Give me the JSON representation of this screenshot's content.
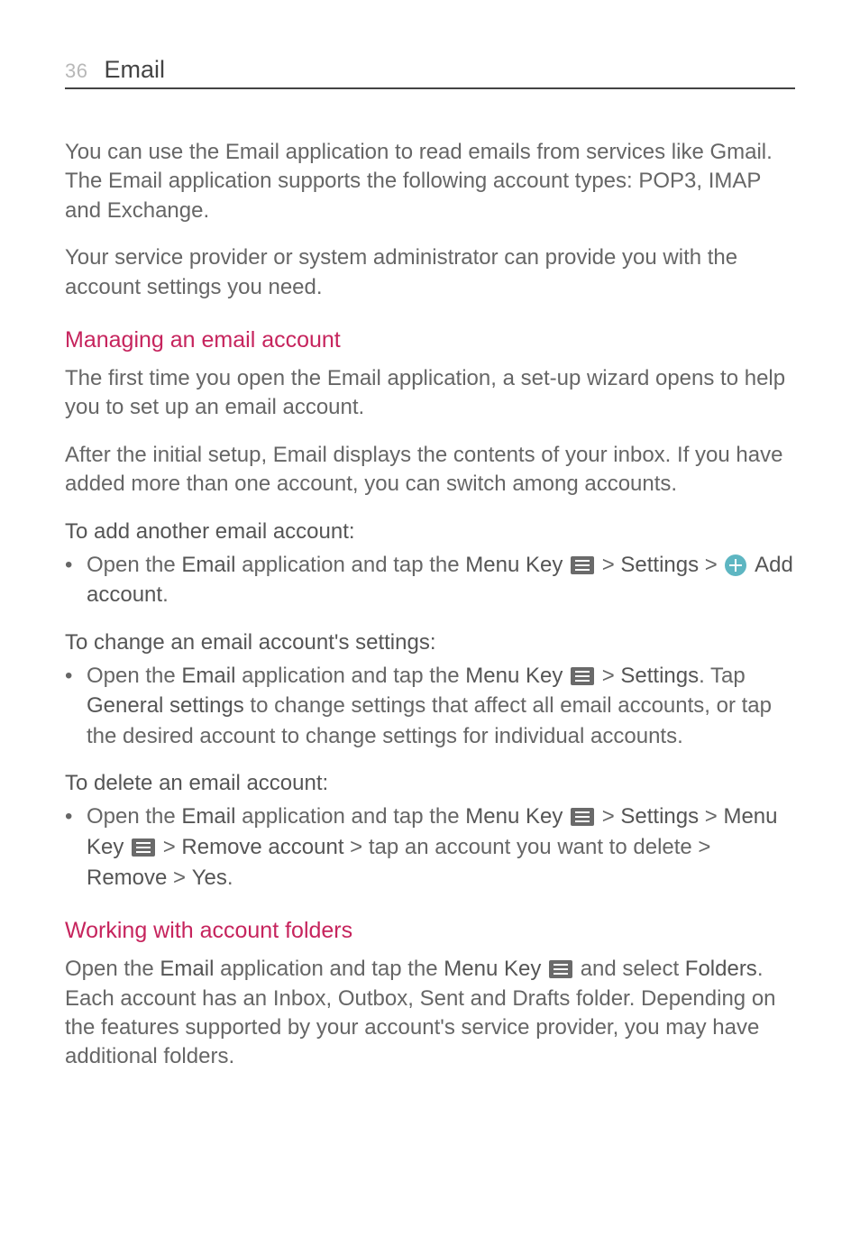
{
  "header": {
    "page_number": "36",
    "section_title": "Email"
  },
  "intro": {
    "p1": "You can use the Email application to read emails from services like Gmail. The Email application supports the following account types: POP3, IMAP and Exchange.",
    "p2": "Your service provider or system administrator can provide you with the account settings you need."
  },
  "manage": {
    "heading": "Managing an email account",
    "p1": "The first time you open the Email application, a set-up wizard opens to help you to set up an email account.",
    "p2": "After the initial setup, Email displays the contents of your inbox. If you have added more than one account, you can switch among accounts."
  },
  "add": {
    "heading": "To add another email account:",
    "b1_prefix": "Open the ",
    "b1_email": "Email",
    "b1_mid": " application and tap the ",
    "b1_menu_key": "Menu Key",
    "b1_gt1": " > ",
    "b1_settings": "Settings",
    "b1_gt2": " > ",
    "b1_add_account": "Add account",
    "b1_period": "."
  },
  "change": {
    "heading": "To change an email account's settings:",
    "b1_prefix": "Open the ",
    "b1_email": "Email",
    "b1_mid": " application and tap the ",
    "b1_menu_key": "Menu Key",
    "b1_gt": " > ",
    "b1_settings": "Settings",
    "b1_after_settings": ". Tap ",
    "b1_general": "General settings",
    "b1_tail": " to change settings that affect all email accounts, or tap the desired account to change settings for individual accounts."
  },
  "delete": {
    "heading": "To delete an email account:",
    "b1_prefix": "Open the ",
    "b1_email": "Email",
    "b1_mid": " application and tap the ",
    "b1_menu_key": "Menu Key",
    "b1_gt1": " > ",
    "b1_settings": "Settings",
    "b1_gt2": " > ",
    "b1_menu_key2": "Menu Key",
    "b1_gt3": " > ",
    "b1_remove_account": "Remove account",
    "b1_tap": " > tap an account you want to delete > ",
    "b1_remove": "Remove",
    "b1_gt4": " > ",
    "b1_yes": "Yes",
    "b1_period": "."
  },
  "folders": {
    "heading": "Working with account folders",
    "p1_prefix": "Open the ",
    "p1_email": "Email",
    "p1_mid": " application and tap the ",
    "p1_menu_key": "Menu Key",
    "p1_and_select": " and select ",
    "p1_folders": "Folders",
    "p1_tail": ". Each account has an Inbox, Outbox, Sent and Drafts folder. Depending on the features supported by your account's service provider, you may have additional folders."
  }
}
